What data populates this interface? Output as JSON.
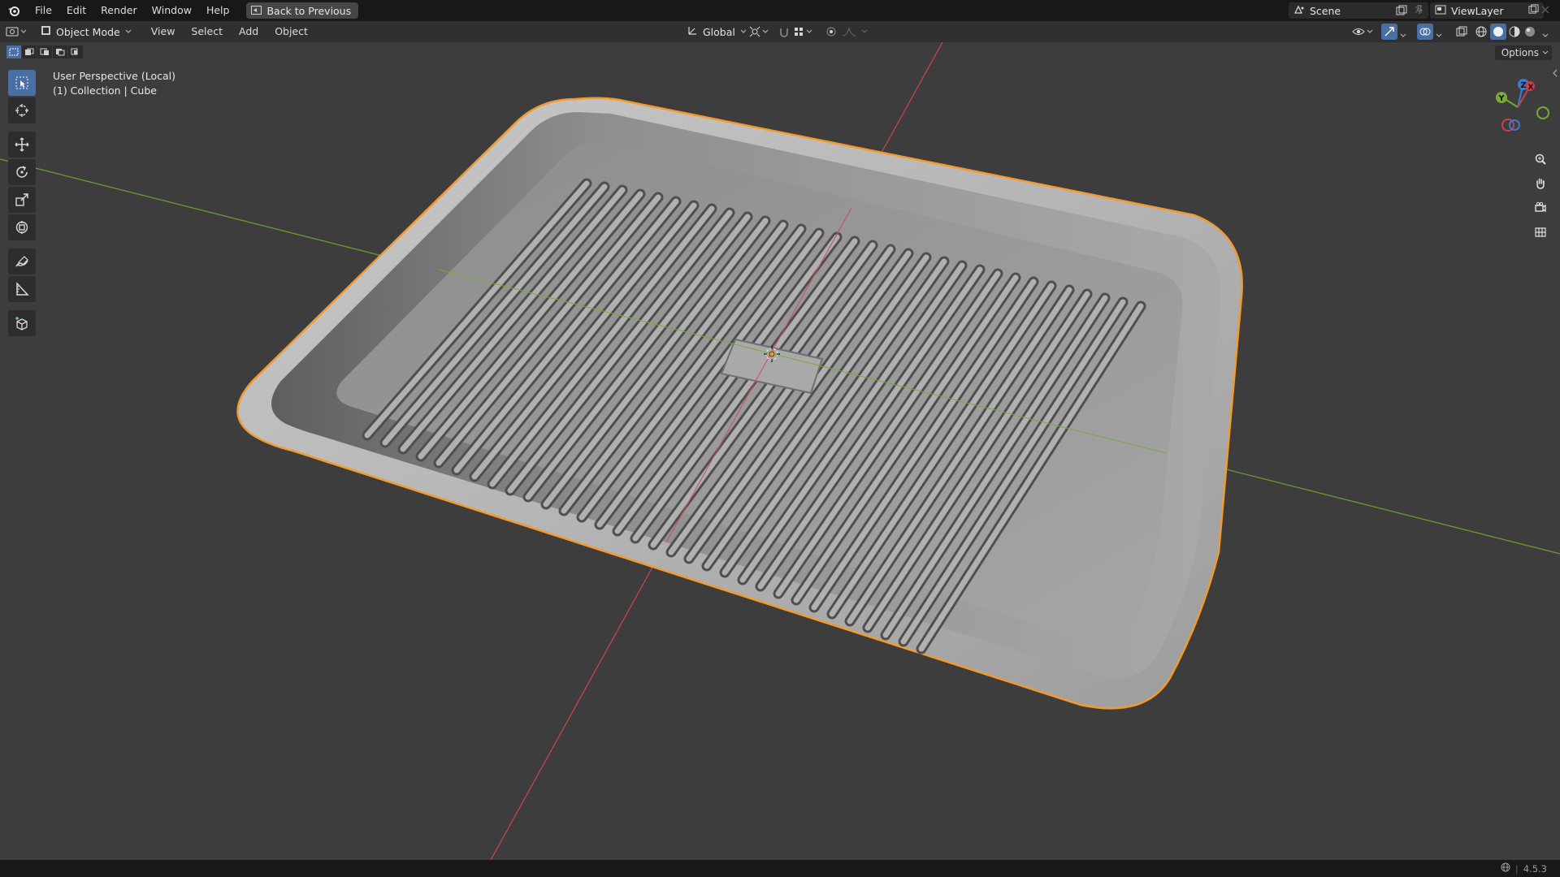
{
  "menubar": {
    "items": [
      "File",
      "Edit",
      "Render",
      "Window",
      "Help"
    ],
    "back_button": "Back to Previous",
    "scene": "Scene",
    "view_layer": "ViewLayer"
  },
  "header": {
    "mode": "Object Mode",
    "menus": [
      "View",
      "Select",
      "Add",
      "Object"
    ],
    "orientation": "Global",
    "options": "Options"
  },
  "viewport": {
    "perspective": "User Perspective (Local)",
    "collection": "(1) Collection | Cube"
  },
  "gizmo": {
    "x": "X",
    "y": "Y",
    "z": "Z"
  },
  "status": {
    "version": "4.5.3"
  },
  "colors": {
    "selection_outline": "#f39a2e",
    "x_axis": "#c8414d",
    "y_axis": "#6b9a2e",
    "active_tool": "#4a6fa5"
  }
}
